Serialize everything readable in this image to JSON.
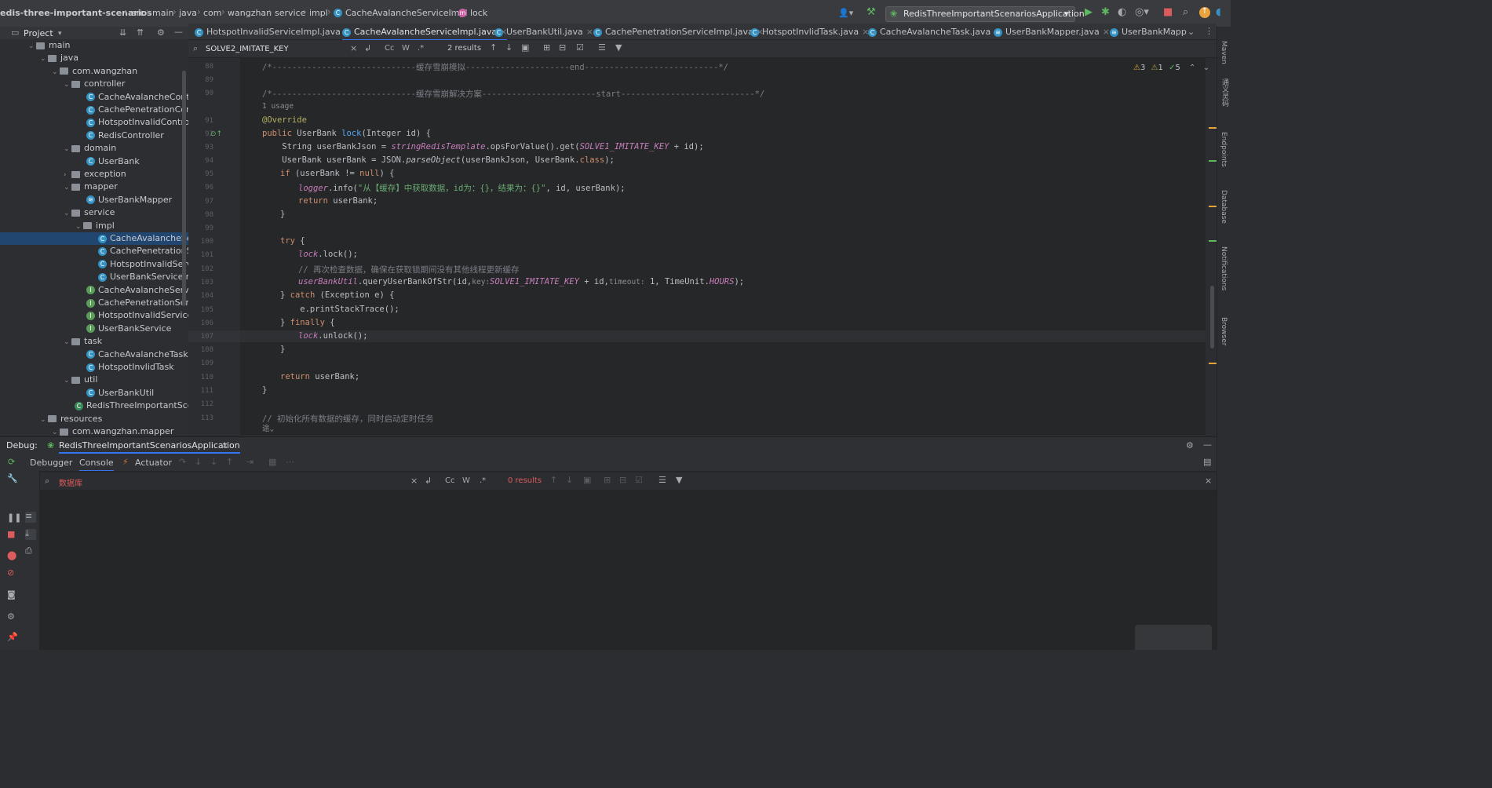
{
  "breadcrumbs": [
    "edis-three-important-scenarios",
    "src",
    "main",
    "java",
    "com",
    "wangzhan",
    "service",
    "impl",
    "CacheAvalancheServiceImpl",
    "lock"
  ],
  "run_config": "RedisThreeImportantScenariosApplication",
  "project_panel": {
    "title": "Project",
    "tree": [
      {
        "label": "main",
        "type": "folder",
        "indent": 0
      },
      {
        "label": "java",
        "type": "folder",
        "indent": 1
      },
      {
        "label": "com.wangzhan",
        "type": "folder",
        "indent": 2
      },
      {
        "label": "controller",
        "type": "folder",
        "indent": 3
      },
      {
        "label": "CacheAvalancheContro",
        "type": "class",
        "indent": 4
      },
      {
        "label": "CachePenetrationContr",
        "type": "class",
        "indent": 4
      },
      {
        "label": "HotspotInvalidControlle",
        "type": "class",
        "indent": 4
      },
      {
        "label": "RedisController",
        "type": "class",
        "indent": 4
      },
      {
        "label": "domain",
        "type": "folder",
        "indent": 3
      },
      {
        "label": "UserBank",
        "type": "class",
        "indent": 4
      },
      {
        "label": "exception",
        "type": "folder-collapsed",
        "indent": 3
      },
      {
        "label": "mapper",
        "type": "folder",
        "indent": 3
      },
      {
        "label": "UserBankMapper",
        "type": "mapper",
        "indent": 4
      },
      {
        "label": "service",
        "type": "folder",
        "indent": 3
      },
      {
        "label": "impl",
        "type": "folder",
        "indent": 4
      },
      {
        "label": "CacheAvalancheServ",
        "type": "class",
        "indent": 5,
        "selected": true
      },
      {
        "label": "CachePenetrationSe",
        "type": "class",
        "indent": 5
      },
      {
        "label": "HotspotInvalidServic",
        "type": "class",
        "indent": 5
      },
      {
        "label": "UserBankServiceImp",
        "type": "class",
        "indent": 5
      },
      {
        "label": "CacheAvalancheService",
        "type": "interface",
        "indent": 4
      },
      {
        "label": "CachePenetrationServic",
        "type": "interface",
        "indent": 4
      },
      {
        "label": "HotspotInvalidService",
        "type": "interface",
        "indent": 4
      },
      {
        "label": "UserBankService",
        "type": "interface",
        "indent": 4
      },
      {
        "label": "task",
        "type": "folder",
        "indent": 3
      },
      {
        "label": "CacheAvalancheTask",
        "type": "class",
        "indent": 4
      },
      {
        "label": "HotspotInvlidTask",
        "type": "class",
        "indent": 4
      },
      {
        "label": "util",
        "type": "folder",
        "indent": 3
      },
      {
        "label": "UserBankUtil",
        "type": "class",
        "indent": 4
      },
      {
        "label": "RedisThreeImportantScena",
        "type": "app",
        "indent": 3
      },
      {
        "label": "resources",
        "type": "folder",
        "indent": 1
      },
      {
        "label": "com.wangzhan.mapper",
        "type": "folder",
        "indent": 2
      }
    ]
  },
  "editor_tabs": [
    {
      "label": "HotspotInvalidServiceImpl.java",
      "active": false
    },
    {
      "label": "CacheAvalancheServiceImpl.java",
      "active": true
    },
    {
      "label": "UserBankUtil.java",
      "active": false
    },
    {
      "label": "CachePenetrationServiceImpl.java",
      "active": false
    },
    {
      "label": "HotspotInvlidTask.java",
      "active": false
    },
    {
      "label": "CacheAvalancheTask.java",
      "active": false
    },
    {
      "label": "UserBankMapper.java",
      "active": false
    },
    {
      "label": "UserBankMapp",
      "active": false
    }
  ],
  "find_bar": {
    "query": "SOLVE2_IMITATE_KEY",
    "results": "2 results",
    "case_label": "Cc",
    "word_label": "W",
    "regex_label": ".*"
  },
  "inspections": {
    "warnings": "3",
    "weak_warnings": "1",
    "ok": "5"
  },
  "code": {
    "line_numbers": [
      "88",
      "89",
      "90",
      "",
      "91",
      "92",
      "93",
      "94",
      "95",
      "96",
      "97",
      "98",
      "99",
      "100",
      "101",
      "102",
      "103",
      "104",
      "105",
      "106",
      "107",
      "108",
      "109",
      "110",
      "111",
      "112",
      "113"
    ],
    "comment_end": "/*-----------------------------缓存雪崩模拟---------------------end---------------------------*/",
    "comment_start": "/*-----------------------------缓存雪崩解决方案-----------------------start---------------------------*/",
    "usage_hint": "1 usage",
    "override": "@Override",
    "l92_kw": "public",
    "l92_rest": " UserBank ",
    "l92_fn": "lock",
    "l92_tail": "(Integer id) {",
    "l93_pre": "    String userBankJson = ",
    "l93_fld": "stringRedisTemplate",
    "l93_mid": ".opsForValue().get(",
    "l93_const": "SOLVE1_IMITATE_KEY",
    "l93_tail": " + id);",
    "l94_pre": "    UserBank userBank = JSON.",
    "l94_static": "parseObject",
    "l94_mid": "(userBankJson, UserBank.",
    "l94_kw": "class",
    "l94_tail": ");",
    "l95_kw": "if",
    "l95_mid": " (userBank != ",
    "l95_null": "null",
    "l95_tail": ") {",
    "l96_fld": "logger",
    "l96_mid": ".info(",
    "l96_str": "\"从【缓存】中获取数据，id为：{}，结果为：{}\"",
    "l96_tail": ", id, userBank);",
    "l97_kw": "return",
    "l97_tail": " userBank;",
    "close_brace": "}",
    "l100_kw": "try",
    "l100_tail": " {",
    "l101_fld": "lock",
    "l101_tail": ".lock();",
    "l102_cm": "// 再次检查数据，确保在获取锁期间没有其他线程更新缓存",
    "l103_fld": "userBankUtil",
    "l103_mid": ".queryUserBankOfStr(id,",
    "l103_hint_key": "key:",
    "l103_const": "SOLVE1_IMITATE_KEY",
    "l103_mid2": " + id,",
    "l103_hint_timeout": "timeout:",
    "l103_mid3": " 1, TimeUnit.",
    "l103_enum": "HOURS",
    "l103_tail": ");",
    "l104_pre": "} ",
    "l104_kw": "catch",
    "l104_tail": " (Exception e) {",
    "l105": "    e.printStackTrace();",
    "l106_pre": "} ",
    "l106_kw": "finally",
    "l106_tail": " {",
    "l107_fld": "lock",
    "l107_tail": ".unlock();",
    "l110_kw": "return",
    "l110_tail": " userBank;",
    "l113_cm": "// 初始化所有数据的缓存，同时启动定时任务",
    "fold_hint": "途⌄"
  },
  "right_strip": [
    "Maven",
    "通义灵码",
    "Endpoints",
    "Database",
    "Notifications",
    "Browser"
  ],
  "debug": {
    "label": "Debug:",
    "session": "RedisThreeImportantScenariosApplication",
    "tabs": [
      "Debugger",
      "Console",
      "Actuator"
    ],
    "active_tab": "Console",
    "search_query": "数据库",
    "search_results": "0 results",
    "case_label": "Cc",
    "word_label": "W",
    "regex_label": ".*"
  },
  "colors": {
    "accent": "#3574f0",
    "selection": "#21466f",
    "warning": "#e2a43b",
    "ok": "#5fb85f"
  }
}
